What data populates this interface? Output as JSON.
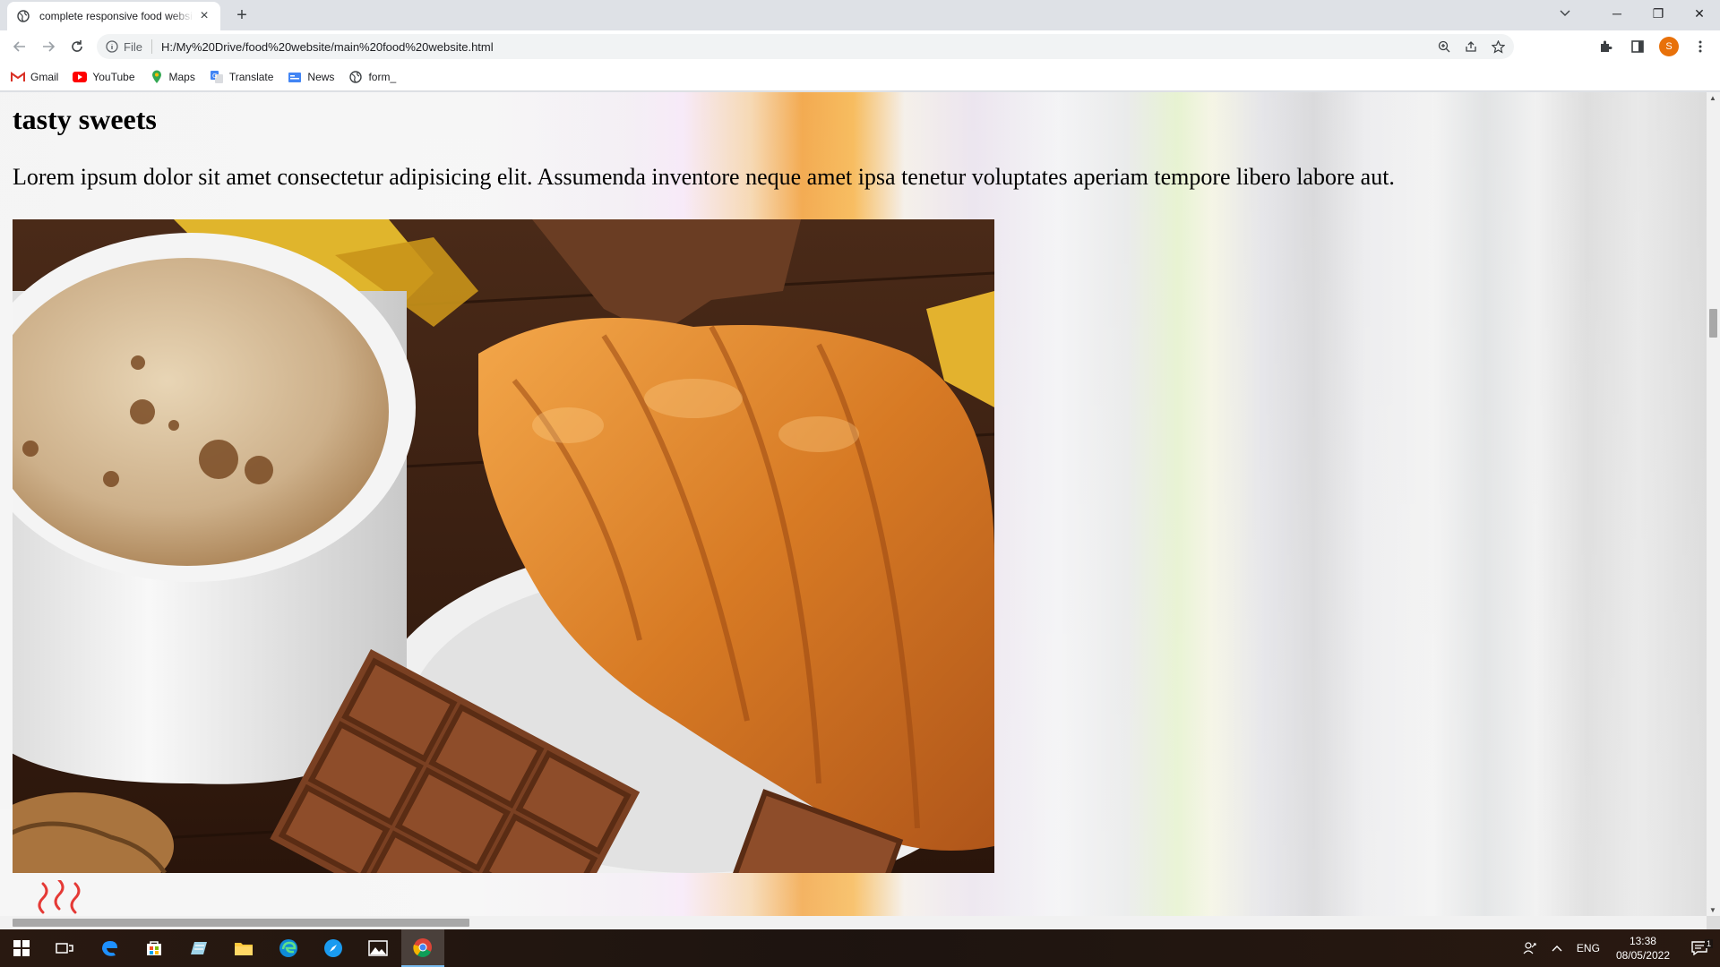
{
  "browser": {
    "tab": {
      "title": "complete responsive food websi",
      "close": "×"
    },
    "new_tab": "+",
    "window_controls": {
      "minimize": "─",
      "restore": "❐",
      "close": "✕"
    },
    "address": {
      "scheme_label": "File",
      "url": "H:/My%20Drive/food%20website/main%20food%20website.html"
    },
    "profile_initial": "S",
    "bookmarks": [
      {
        "label": "Gmail",
        "icon": "gmail-icon"
      },
      {
        "label": "YouTube",
        "icon": "youtube-icon"
      },
      {
        "label": "Maps",
        "icon": "maps-icon"
      },
      {
        "label": "Translate",
        "icon": "translate-icon"
      },
      {
        "label": "News",
        "icon": "news-icon"
      },
      {
        "label": "form_",
        "icon": "globe-icon"
      }
    ]
  },
  "page": {
    "heading": "tasty sweets",
    "paragraph": "Lorem ipsum dolor sit amet consectetur adipisicing elit. Assumenda inventore neque amet ipsa tenetur voluptates aperiam tempore libero labore aut.",
    "hero_image": "coffee cup with croissant and chocolate"
  },
  "taskbar": {
    "language": "ENG",
    "time": "13:38",
    "date": "08/05/2022",
    "notification_count": "1"
  },
  "colors": {
    "accent_orange": "#e8710a",
    "taskbar_active": "#76b9ed"
  }
}
